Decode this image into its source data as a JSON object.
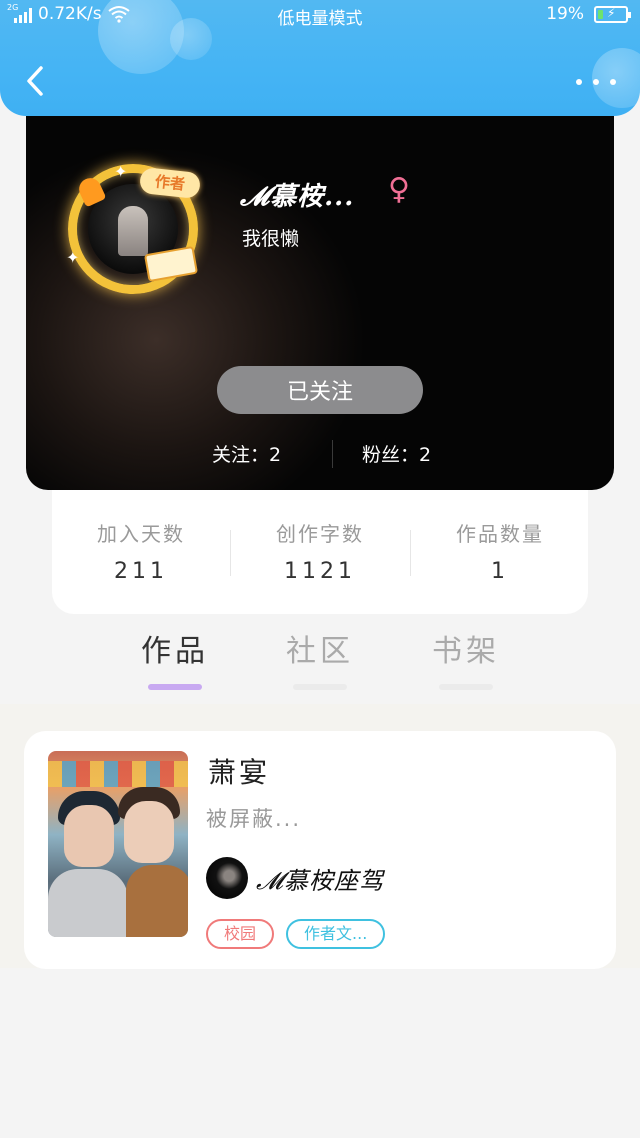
{
  "status_bar": {
    "network_type": "2G",
    "speed": "0.72K/s",
    "mode": "低电量模式",
    "battery": "19%",
    "battery_level": 0.19
  },
  "header": {
    "back_icon": "back-arrow-icon",
    "more_icon": "more-dots-icon"
  },
  "profile": {
    "badge": "作者",
    "nickname": "𝓜慕桉...",
    "gender_symbol": "♀",
    "bio": "我很懒",
    "follow_button": "已关注",
    "following": "关注：2",
    "fans": "粉丝：2"
  },
  "stats": [
    {
      "label": "加入天数",
      "value": "211"
    },
    {
      "label": "创作字数",
      "value": "1121"
    },
    {
      "label": "作品数量",
      "value": "1"
    }
  ],
  "tabs": [
    {
      "label": "作品",
      "active": true
    },
    {
      "label": "社区",
      "active": false
    },
    {
      "label": "书架",
      "active": false
    }
  ],
  "works": [
    {
      "title": "萧宴",
      "description": "被屏蔽...",
      "author": "𝓜慕桉座驾",
      "tags": [
        {
          "label": "校园",
          "color": "#f07a7a"
        },
        {
          "label": "作者文...",
          "color": "#3fc1e0"
        }
      ]
    }
  ],
  "colors": {
    "header_blue": "#45b4f4",
    "tab_underline_active": "#c8a9f1",
    "gender_pink": "#f06f95",
    "follow_button_gray": "#8c8c8e"
  }
}
